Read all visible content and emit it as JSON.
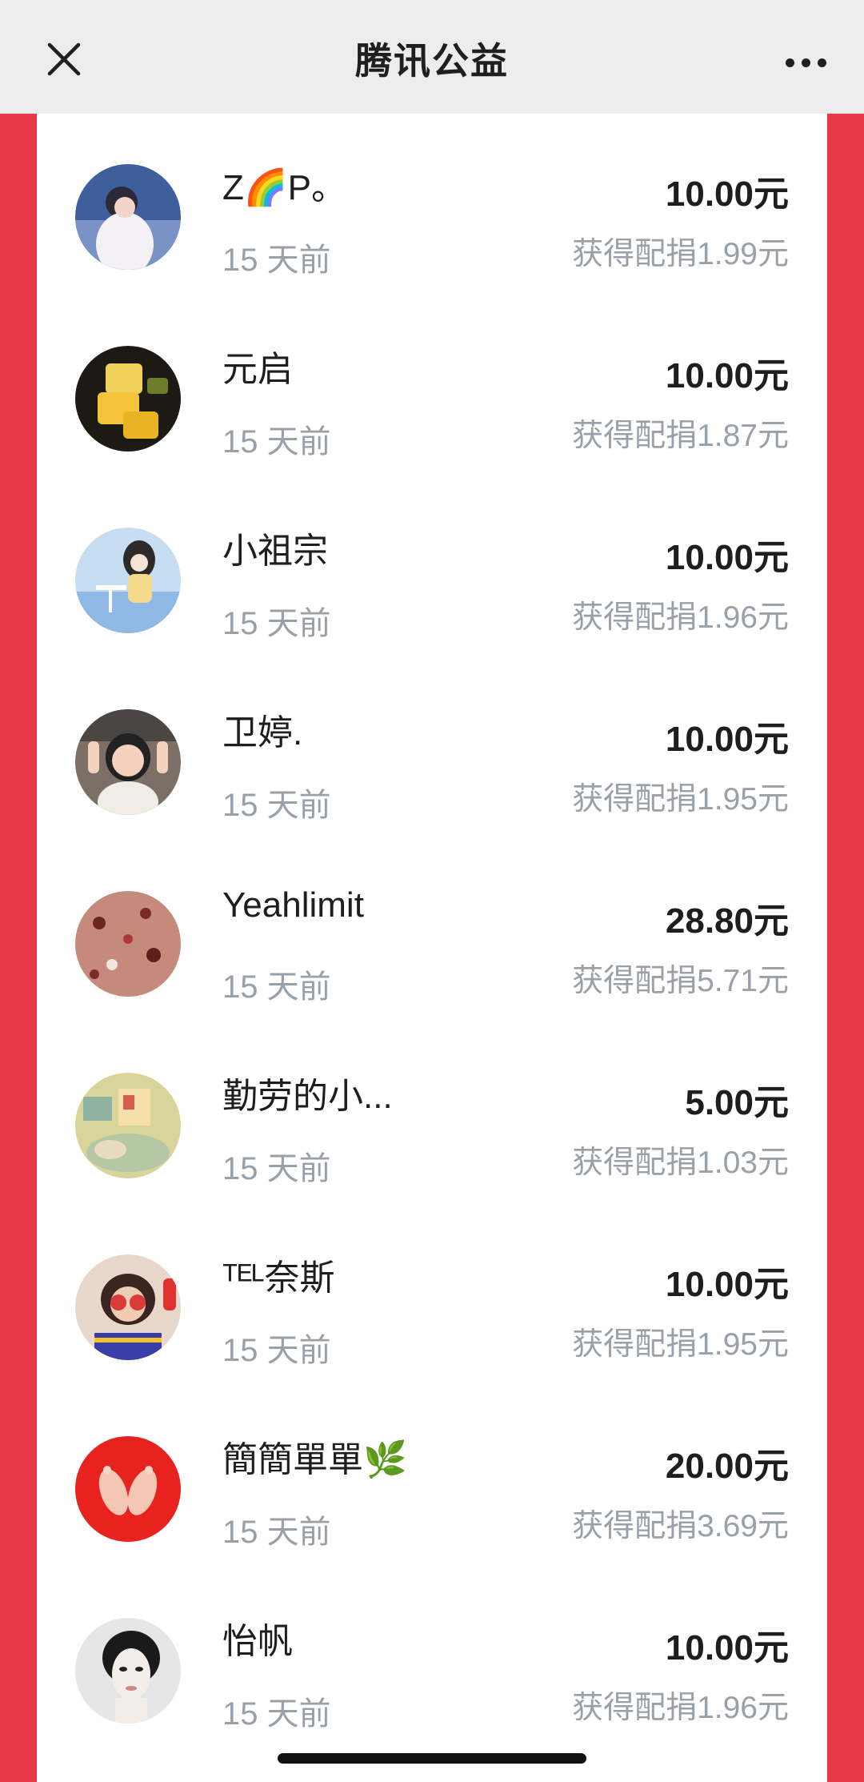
{
  "header": {
    "title": "腾讯公益",
    "close_icon": "close-icon",
    "more_icon": "more-icon"
  },
  "donations": [
    {
      "name": "Z🌈P。",
      "time": "15 天前",
      "amount": "10.00元",
      "match": "获得配捐1.99元",
      "avatar": "photo-girl-white-hoodie"
    },
    {
      "name": "元启",
      "time": "15 天前",
      "amount": "10.00元",
      "match": "获得配捐1.87元",
      "avatar": "photo-honey-cake"
    },
    {
      "name": "小祖宗",
      "time": "15 天前",
      "amount": "10.00元",
      "match": "获得配捐1.96元",
      "avatar": "illustration-girl-sitting"
    },
    {
      "name": "卫婷.",
      "time": "15 天前",
      "amount": "10.00元",
      "match": "获得配捐1.95元",
      "avatar": "photo-smiling-child"
    },
    {
      "name": "Yeahlimit",
      "time": "15 天前",
      "amount": "28.80元",
      "match": "获得配捐5.71元",
      "avatar": "photo-fruit-cake"
    },
    {
      "name": "勤劳的小...",
      "time": "15 天前",
      "amount": "5.00元",
      "match": "获得配捐1.03元",
      "avatar": "illustration-cozy-room"
    },
    {
      "name": "ᵀᴱᴸ奈斯",
      "time": "15 天前",
      "amount": "10.00元",
      "match": "获得配捐1.95元",
      "avatar": "photo-child-flower-glasses"
    },
    {
      "name": "簡簡單單🌿",
      "time": "15 天前",
      "amount": "20.00元",
      "match": "获得配捐3.69元",
      "avatar": "photo-red-background-feet"
    },
    {
      "name": "怡帆",
      "time": "15 天前",
      "amount": "10.00元",
      "match": "获得配捐1.96元",
      "avatar": "photo-classic-portrait"
    }
  ],
  "colors": {
    "page_background": "#e73c47",
    "header_background": "#ededed",
    "text_primary": "#1e1e1e",
    "text_secondary": "#9aa0a8"
  }
}
